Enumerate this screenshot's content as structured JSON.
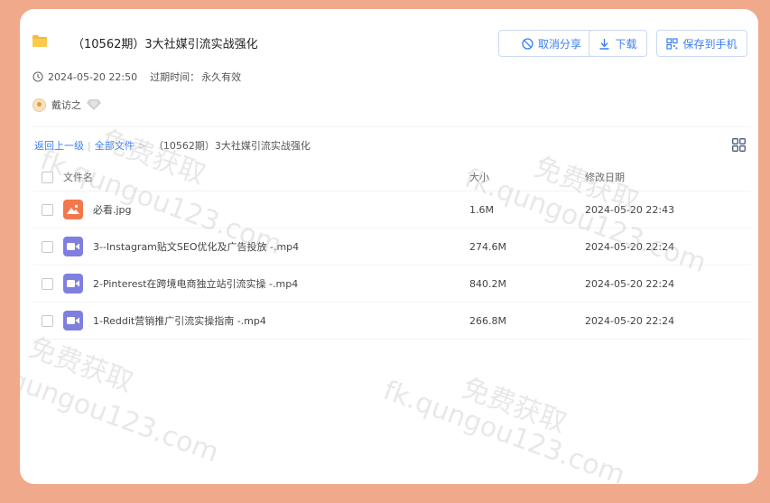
{
  "share": {
    "title": "（10562期）3大社媒引流实战强化",
    "created_at": "2024-05-20 22:50",
    "expire_label": "过期时间：",
    "expire_value": "永久有效",
    "user_name": "戴访之"
  },
  "actions": {
    "cancel_share": "取消分享",
    "download": "下载",
    "save_to_phone": "保存到手机"
  },
  "breadcrumb": {
    "back": "返回上一级",
    "all_files": "全部文件",
    "current": "（10562期）3大社媒引流实战强化"
  },
  "table": {
    "headers": {
      "name": "文件名",
      "size": "大小",
      "date": "修改日期"
    },
    "rows": [
      {
        "name": "必看.jpg",
        "size": "1.6M",
        "date": "2024-05-20 22:43",
        "icon": "image-file-icon"
      },
      {
        "name": "3--Instagram贴文SEO优化及广告投放 -.mp4",
        "size": "274.6M",
        "date": "2024-05-20 22:24",
        "icon": "video-file-icon"
      },
      {
        "name": "2-Pinterest在跨境电商独立站引流实操 -.mp4",
        "size": "840.2M",
        "date": "2024-05-20 22:24",
        "icon": "video-file-icon"
      },
      {
        "name": "1-Reddit营销推广引流实操指南 -.mp4",
        "size": "266.8M",
        "date": "2024-05-20 22:24",
        "icon": "video-file-icon"
      }
    ]
  },
  "watermarks": [
    "免费获取",
    "fk.qungou123.com"
  ],
  "colors": {
    "accent": "#3b7ff0",
    "background": "#f0a98a",
    "image_icon": "#f2784b",
    "video_icon": "#7f7fe0"
  }
}
